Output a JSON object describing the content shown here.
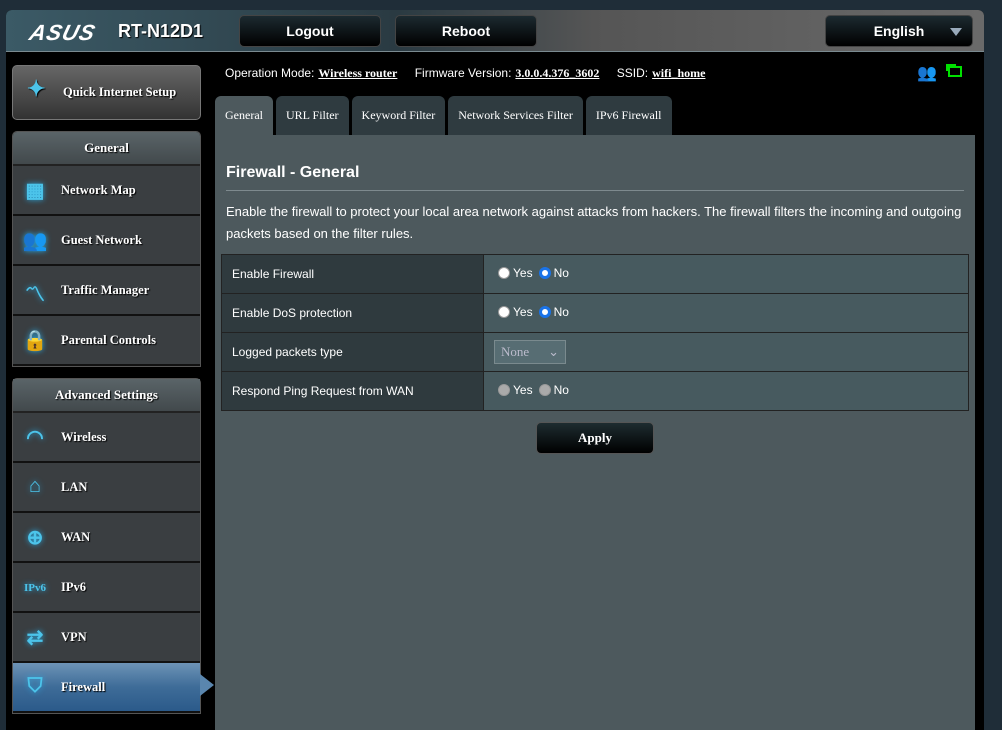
{
  "header": {
    "brand": "ASUS",
    "model": "RT-N12D1",
    "logout": "Logout",
    "reboot": "Reboot",
    "language": "English"
  },
  "info": {
    "op_label": "Operation Mode:",
    "op_value": "Wireless router",
    "fw_label": "Firmware Version:",
    "fw_value": "3.0.0.4.376_3602",
    "ssid_label": "SSID:",
    "ssid_value": "wifi_home"
  },
  "sidebar": {
    "quick": "Quick Internet Setup",
    "general_title": "General",
    "general": [
      {
        "label": "Network Map",
        "icon": "network-map-icon"
      },
      {
        "label": "Guest Network",
        "icon": "guest-network-icon"
      },
      {
        "label": "Traffic Manager",
        "icon": "traffic-manager-icon"
      },
      {
        "label": "Parental Controls",
        "icon": "lock-icon"
      }
    ],
    "advanced_title": "Advanced Settings",
    "advanced": [
      {
        "label": "Wireless",
        "icon": "wifi-icon"
      },
      {
        "label": "LAN",
        "icon": "house-icon"
      },
      {
        "label": "WAN",
        "icon": "globe-icon"
      },
      {
        "label": "IPv6",
        "icon": "ipv6-globe-icon"
      },
      {
        "label": "VPN",
        "icon": "vpn-icon"
      },
      {
        "label": "Firewall",
        "icon": "shield-icon",
        "active": true
      }
    ]
  },
  "tabs": [
    "General",
    "URL Filter",
    "Keyword Filter",
    "Network Services Filter",
    "IPv6 Firewall"
  ],
  "main": {
    "title": "Firewall - General",
    "description": "Enable the firewall to protect your local area network against attacks from hackers. The firewall filters the incoming and outgoing packets based on the filter rules.",
    "rows": [
      {
        "label": "Enable Firewall",
        "yes": "Yes",
        "no": "No",
        "value": "No"
      },
      {
        "label": "Enable DoS protection",
        "yes": "Yes",
        "no": "No",
        "value": "No"
      },
      {
        "label": "Logged packets type",
        "select": "None"
      },
      {
        "label": "Respond Ping Request from WAN",
        "yes": "Yes",
        "no": "No",
        "disabled": true
      }
    ],
    "apply": "Apply"
  },
  "colors": {
    "accent": "#4cc4ea",
    "panel": "#4d595d",
    "status_green": "#00e000"
  }
}
